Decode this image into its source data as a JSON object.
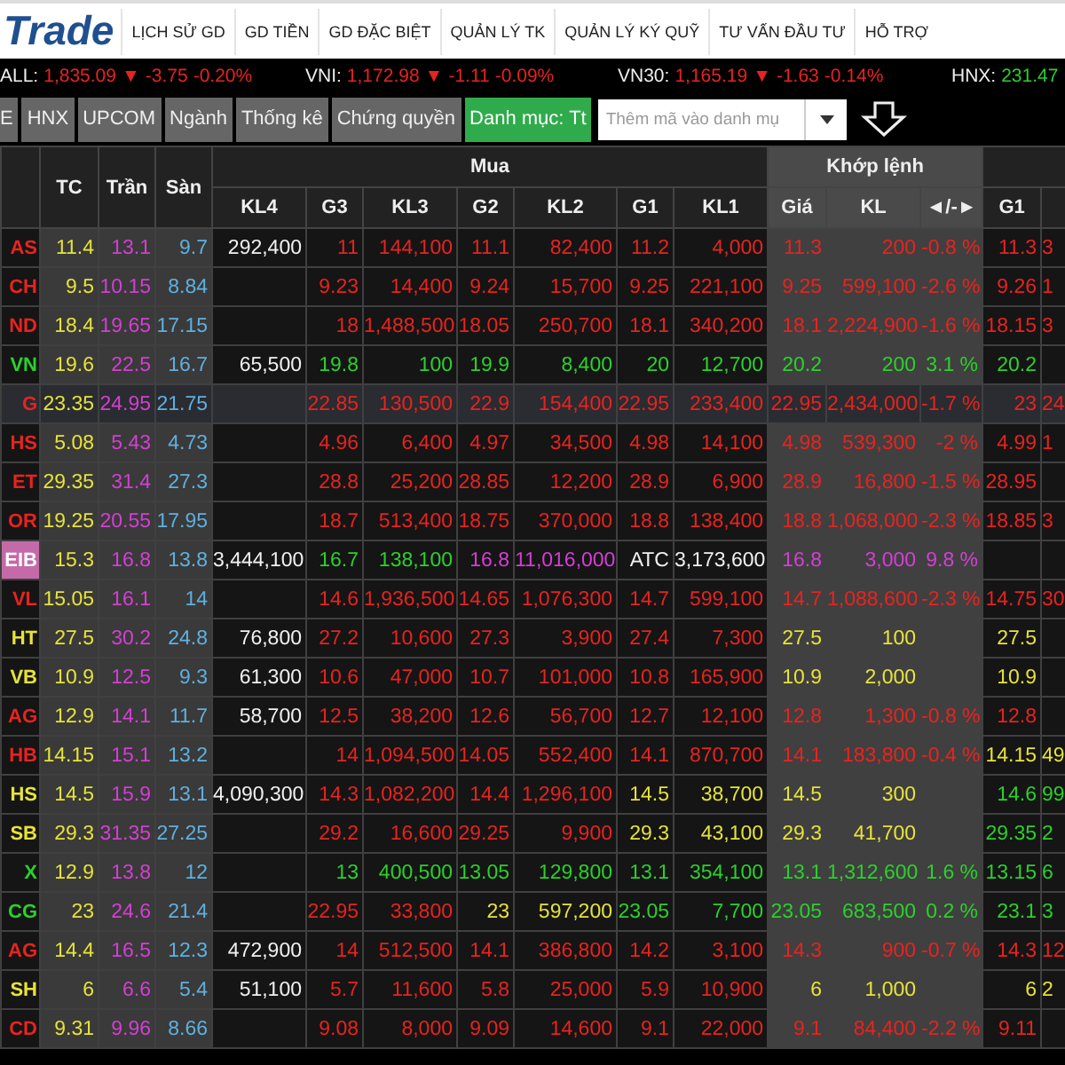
{
  "logo": "Trade",
  "menu": [
    "LỊCH SỬ GD",
    "GD TIỀN",
    "GD ĐẶC BIỆT",
    "QUẢN LÝ TK",
    "QUẢN LÝ KÝ QUỸ",
    "TƯ VẤN ĐẦU TƯ",
    "HỖ TRỢ"
  ],
  "indices": [
    {
      "label": "ALL:",
      "value": "1,835.09",
      "arrow": "▼",
      "change": "-3.75",
      "percent": "-0.20%",
      "color": "#e8231f"
    },
    {
      "label": "VNI:",
      "value": "1,172.98",
      "arrow": "▼",
      "change": "-1.11",
      "percent": "-0.09%",
      "color": "#e8231f"
    },
    {
      "label": "VN30:",
      "value": "1,165.19",
      "arrow": "▼",
      "change": "-1.63",
      "percent": "-0.14%",
      "color": "#e8231f"
    },
    {
      "label": "HNX:",
      "value": "231.47",
      "color": "#2bd12b"
    }
  ],
  "tabs": [
    {
      "label": "E",
      "selected": false
    },
    {
      "label": "HNX",
      "selected": false
    },
    {
      "label": "UPCOM",
      "selected": false
    },
    {
      "label": "Ngành",
      "selected": false
    },
    {
      "label": "Thống kê",
      "selected": false
    },
    {
      "label": "Chứng quyền",
      "selected": false
    },
    {
      "label": "Danh mục: Tt",
      "selected": true
    }
  ],
  "search": {
    "placeholder": "Thêm mã vào danh mụ"
  },
  "table": {
    "groups": [
      "Mua",
      "Khớp lệnh"
    ],
    "columns": [
      "TC",
      "Trần",
      "Sàn",
      "KL4",
      "G3",
      "KL3",
      "G2",
      "KL2",
      "G1",
      "KL1",
      "Giá",
      "KL",
      "◄/-►",
      "G1"
    ],
    "rows": [
      {
        "symbol": "AS",
        "color": "#e8231f",
        "selected": false,
        "highlighted": false,
        "cells": [
          {
            "text": "11.4",
            "color": "#e6e33a"
          },
          {
            "text": "13.1",
            "color": "#d43fd4"
          },
          {
            "text": "9.7",
            "color": "#5fb0e0"
          },
          {
            "text": "292,400",
            "color": "#f0f0f0"
          },
          {
            "text": "11",
            "color": "#e8231f"
          },
          {
            "text": "144,100",
            "color": "#e8231f"
          },
          {
            "text": "11.1",
            "color": "#e8231f"
          },
          {
            "text": "82,400",
            "color": "#e8231f"
          },
          {
            "text": "11.2",
            "color": "#e8231f"
          },
          {
            "text": "4,000",
            "color": "#e8231f"
          },
          {
            "text": "11.3",
            "color": "#e8231f"
          },
          {
            "text": "200",
            "color": "#e8231f"
          },
          {
            "text": "-0.8 %",
            "color": "#e8231f"
          },
          {
            "text": "11.3",
            "color": "#e8231f"
          },
          {
            "text": "3",
            "color": "#e8231f"
          }
        ]
      },
      {
        "symbol": "CH",
        "color": "#e8231f",
        "selected": false,
        "highlighted": false,
        "cells": [
          {
            "text": "9.5",
            "color": "#e6e33a"
          },
          {
            "text": "10.15",
            "color": "#d43fd4"
          },
          {
            "text": "8.84",
            "color": "#5fb0e0"
          },
          null,
          {
            "text": "9.23",
            "color": "#e8231f"
          },
          {
            "text": "14,400",
            "color": "#e8231f"
          },
          {
            "text": "9.24",
            "color": "#e8231f"
          },
          {
            "text": "15,700",
            "color": "#e8231f"
          },
          {
            "text": "9.25",
            "color": "#e8231f"
          },
          {
            "text": "221,100",
            "color": "#e8231f"
          },
          {
            "text": "9.25",
            "color": "#e8231f"
          },
          {
            "text": "599,100",
            "color": "#e8231f"
          },
          {
            "text": "-2.6 %",
            "color": "#e8231f"
          },
          {
            "text": "9.26",
            "color": "#e8231f"
          },
          {
            "text": "1",
            "color": "#e8231f"
          }
        ]
      },
      {
        "symbol": "ND",
        "color": "#e8231f",
        "selected": false,
        "highlighted": false,
        "cells": [
          {
            "text": "18.4",
            "color": "#e6e33a"
          },
          {
            "text": "19.65",
            "color": "#d43fd4"
          },
          {
            "text": "17.15",
            "color": "#5fb0e0"
          },
          null,
          {
            "text": "18",
            "color": "#e8231f"
          },
          {
            "text": "1,488,500",
            "color": "#e8231f"
          },
          {
            "text": "18.05",
            "color": "#e8231f"
          },
          {
            "text": "250,700",
            "color": "#e8231f"
          },
          {
            "text": "18.1",
            "color": "#e8231f"
          },
          {
            "text": "340,200",
            "color": "#e8231f"
          },
          {
            "text": "18.1",
            "color": "#e8231f"
          },
          {
            "text": "2,224,900",
            "color": "#e8231f"
          },
          {
            "text": "-1.6 %",
            "color": "#e8231f"
          },
          {
            "text": "18.15",
            "color": "#e8231f"
          },
          {
            "text": "3",
            "color": "#e8231f"
          }
        ]
      },
      {
        "symbol": "VN",
        "color": "#2bd12b",
        "selected": false,
        "highlighted": false,
        "cells": [
          {
            "text": "19.6",
            "color": "#e6e33a"
          },
          {
            "text": "22.5",
            "color": "#d43fd4"
          },
          {
            "text": "16.7",
            "color": "#5fb0e0"
          },
          {
            "text": "65,500",
            "color": "#f0f0f0"
          },
          {
            "text": "19.8",
            "color": "#2bd12b"
          },
          {
            "text": "100",
            "color": "#2bd12b"
          },
          {
            "text": "19.9",
            "color": "#2bd12b"
          },
          {
            "text": "8,400",
            "color": "#2bd12b"
          },
          {
            "text": "20",
            "color": "#2bd12b"
          },
          {
            "text": "12,700",
            "color": "#2bd12b"
          },
          {
            "text": "20.2",
            "color": "#2bd12b"
          },
          {
            "text": "200",
            "color": "#2bd12b"
          },
          {
            "text": "3.1 %",
            "color": "#2bd12b"
          },
          {
            "text": "20.2",
            "color": "#2bd12b"
          },
          null
        ]
      },
      {
        "symbol": "G",
        "color": "#e8231f",
        "selected": true,
        "highlighted": false,
        "cells": [
          {
            "text": "23.35",
            "color": "#e6e33a"
          },
          {
            "text": "24.95",
            "color": "#d43fd4"
          },
          {
            "text": "21.75",
            "color": "#5fb0e0"
          },
          null,
          {
            "text": "22.85",
            "color": "#e8231f"
          },
          {
            "text": "130,500",
            "color": "#e8231f"
          },
          {
            "text": "22.9",
            "color": "#e8231f"
          },
          {
            "text": "154,400",
            "color": "#e8231f"
          },
          {
            "text": "22.95",
            "color": "#e8231f"
          },
          {
            "text": "233,400",
            "color": "#e8231f"
          },
          {
            "text": "22.95",
            "color": "#e8231f"
          },
          {
            "text": "2,434,000",
            "color": "#e8231f"
          },
          {
            "text": "-1.7 %",
            "color": "#e8231f"
          },
          {
            "text": "23",
            "color": "#e8231f"
          },
          {
            "text": "24",
            "color": "#e8231f"
          }
        ]
      },
      {
        "symbol": "HS",
        "color": "#e8231f",
        "selected": false,
        "highlighted": false,
        "cells": [
          {
            "text": "5.08",
            "color": "#e6e33a"
          },
          {
            "text": "5.43",
            "color": "#d43fd4"
          },
          {
            "text": "4.73",
            "color": "#5fb0e0"
          },
          null,
          {
            "text": "4.96",
            "color": "#e8231f"
          },
          {
            "text": "6,400",
            "color": "#e8231f"
          },
          {
            "text": "4.97",
            "color": "#e8231f"
          },
          {
            "text": "34,500",
            "color": "#e8231f"
          },
          {
            "text": "4.98",
            "color": "#e8231f"
          },
          {
            "text": "14,100",
            "color": "#e8231f"
          },
          {
            "text": "4.98",
            "color": "#e8231f"
          },
          {
            "text": "539,300",
            "color": "#e8231f"
          },
          {
            "text": "-2 %",
            "color": "#e8231f"
          },
          {
            "text": "4.99",
            "color": "#e8231f"
          },
          {
            "text": "1",
            "color": "#e8231f"
          }
        ]
      },
      {
        "symbol": "ET",
        "color": "#e8231f",
        "selected": false,
        "highlighted": false,
        "cells": [
          {
            "text": "29.35",
            "color": "#e6e33a"
          },
          {
            "text": "31.4",
            "color": "#d43fd4"
          },
          {
            "text": "27.3",
            "color": "#5fb0e0"
          },
          null,
          {
            "text": "28.8",
            "color": "#e8231f"
          },
          {
            "text": "25,200",
            "color": "#e8231f"
          },
          {
            "text": "28.85",
            "color": "#e8231f"
          },
          {
            "text": "12,200",
            "color": "#e8231f"
          },
          {
            "text": "28.9",
            "color": "#e8231f"
          },
          {
            "text": "6,900",
            "color": "#e8231f"
          },
          {
            "text": "28.9",
            "color": "#e8231f"
          },
          {
            "text": "16,800",
            "color": "#e8231f"
          },
          {
            "text": "-1.5 %",
            "color": "#e8231f"
          },
          {
            "text": "28.95",
            "color": "#e8231f"
          },
          null
        ]
      },
      {
        "symbol": "OR",
        "color": "#e8231f",
        "selected": false,
        "highlighted": false,
        "cells": [
          {
            "text": "19.25",
            "color": "#e6e33a"
          },
          {
            "text": "20.55",
            "color": "#d43fd4"
          },
          {
            "text": "17.95",
            "color": "#5fb0e0"
          },
          null,
          {
            "text": "18.7",
            "color": "#e8231f"
          },
          {
            "text": "513,400",
            "color": "#e8231f"
          },
          {
            "text": "18.75",
            "color": "#e8231f"
          },
          {
            "text": "370,000",
            "color": "#e8231f"
          },
          {
            "text": "18.8",
            "color": "#e8231f"
          },
          {
            "text": "138,400",
            "color": "#e8231f"
          },
          {
            "text": "18.8",
            "color": "#e8231f"
          },
          {
            "text": "1,068,000",
            "color": "#e8231f"
          },
          {
            "text": "-2.3 %",
            "color": "#e8231f"
          },
          {
            "text": "18.85",
            "color": "#e8231f"
          },
          {
            "text": "3",
            "color": "#e8231f"
          }
        ]
      },
      {
        "symbol": "EIB",
        "color": "#ffffff",
        "selected": false,
        "highlighted": true,
        "cells": [
          {
            "text": "15.3",
            "color": "#e6e33a"
          },
          {
            "text": "16.8",
            "color": "#d43fd4"
          },
          {
            "text": "13.8",
            "color": "#5fb0e0"
          },
          {
            "text": "3,444,100",
            "color": "#f0f0f0"
          },
          {
            "text": "16.7",
            "color": "#2bd12b"
          },
          {
            "text": "138,100",
            "color": "#2bd12b"
          },
          {
            "text": "16.8",
            "color": "#d43fd4"
          },
          {
            "text": "11,016,000",
            "color": "#d43fd4"
          },
          {
            "text": "ATC",
            "color": "#f0f0f0"
          },
          {
            "text": "3,173,600",
            "color": "#f0f0f0"
          },
          {
            "text": "16.8",
            "color": "#d43fd4"
          },
          {
            "text": "3,000",
            "color": "#d43fd4"
          },
          {
            "text": "9.8 %",
            "color": "#d43fd4"
          },
          null,
          null
        ]
      },
      {
        "symbol": "VL",
        "color": "#e8231f",
        "selected": false,
        "highlighted": false,
        "cells": [
          {
            "text": "15.05",
            "color": "#e6e33a"
          },
          {
            "text": "16.1",
            "color": "#d43fd4"
          },
          {
            "text": "14",
            "color": "#5fb0e0"
          },
          null,
          {
            "text": "14.6",
            "color": "#e8231f"
          },
          {
            "text": "1,936,500",
            "color": "#e8231f"
          },
          {
            "text": "14.65",
            "color": "#e8231f"
          },
          {
            "text": "1,076,300",
            "color": "#e8231f"
          },
          {
            "text": "14.7",
            "color": "#e8231f"
          },
          {
            "text": "599,100",
            "color": "#e8231f"
          },
          {
            "text": "14.7",
            "color": "#e8231f"
          },
          {
            "text": "1,088,600",
            "color": "#e8231f"
          },
          {
            "text": "-2.3 %",
            "color": "#e8231f"
          },
          {
            "text": "14.75",
            "color": "#e8231f"
          },
          {
            "text": "30",
            "color": "#e8231f"
          }
        ]
      },
      {
        "symbol": "HT",
        "color": "#e6e33a",
        "selected": false,
        "highlighted": false,
        "cells": [
          {
            "text": "27.5",
            "color": "#e6e33a"
          },
          {
            "text": "30.2",
            "color": "#d43fd4"
          },
          {
            "text": "24.8",
            "color": "#5fb0e0"
          },
          {
            "text": "76,800",
            "color": "#f0f0f0"
          },
          {
            "text": "27.2",
            "color": "#e8231f"
          },
          {
            "text": "10,600",
            "color": "#e8231f"
          },
          {
            "text": "27.3",
            "color": "#e8231f"
          },
          {
            "text": "3,900",
            "color": "#e8231f"
          },
          {
            "text": "27.4",
            "color": "#e8231f"
          },
          {
            "text": "7,300",
            "color": "#e8231f"
          },
          {
            "text": "27.5",
            "color": "#e6e33a"
          },
          {
            "text": "100",
            "color": "#e6e33a"
          },
          null,
          {
            "text": "27.5",
            "color": "#e6e33a"
          },
          null
        ]
      },
      {
        "symbol": "VB",
        "color": "#e6e33a",
        "selected": false,
        "highlighted": false,
        "cells": [
          {
            "text": "10.9",
            "color": "#e6e33a"
          },
          {
            "text": "12.5",
            "color": "#d43fd4"
          },
          {
            "text": "9.3",
            "color": "#5fb0e0"
          },
          {
            "text": "61,300",
            "color": "#f0f0f0"
          },
          {
            "text": "10.6",
            "color": "#e8231f"
          },
          {
            "text": "47,000",
            "color": "#e8231f"
          },
          {
            "text": "10.7",
            "color": "#e8231f"
          },
          {
            "text": "101,000",
            "color": "#e8231f"
          },
          {
            "text": "10.8",
            "color": "#e8231f"
          },
          {
            "text": "165,900",
            "color": "#e8231f"
          },
          {
            "text": "10.9",
            "color": "#e6e33a"
          },
          {
            "text": "2,000",
            "color": "#e6e33a"
          },
          null,
          {
            "text": "10.9",
            "color": "#e6e33a"
          },
          null
        ]
      },
      {
        "symbol": "AG",
        "color": "#e8231f",
        "selected": false,
        "highlighted": false,
        "cells": [
          {
            "text": "12.9",
            "color": "#e6e33a"
          },
          {
            "text": "14.1",
            "color": "#d43fd4"
          },
          {
            "text": "11.7",
            "color": "#5fb0e0"
          },
          {
            "text": "58,700",
            "color": "#f0f0f0"
          },
          {
            "text": "12.5",
            "color": "#e8231f"
          },
          {
            "text": "38,200",
            "color": "#e8231f"
          },
          {
            "text": "12.6",
            "color": "#e8231f"
          },
          {
            "text": "56,700",
            "color": "#e8231f"
          },
          {
            "text": "12.7",
            "color": "#e8231f"
          },
          {
            "text": "12,100",
            "color": "#e8231f"
          },
          {
            "text": "12.8",
            "color": "#e8231f"
          },
          {
            "text": "1,300",
            "color": "#e8231f"
          },
          {
            "text": "-0.8 %",
            "color": "#e8231f"
          },
          {
            "text": "12.8",
            "color": "#e8231f"
          },
          null
        ]
      },
      {
        "symbol": "HB",
        "color": "#e8231f",
        "selected": false,
        "highlighted": false,
        "cells": [
          {
            "text": "14.15",
            "color": "#e6e33a"
          },
          {
            "text": "15.1",
            "color": "#d43fd4"
          },
          {
            "text": "13.2",
            "color": "#5fb0e0"
          },
          null,
          {
            "text": "14",
            "color": "#e8231f"
          },
          {
            "text": "1,094,500",
            "color": "#e8231f"
          },
          {
            "text": "14.05",
            "color": "#e8231f"
          },
          {
            "text": "552,400",
            "color": "#e8231f"
          },
          {
            "text": "14.1",
            "color": "#e8231f"
          },
          {
            "text": "870,700",
            "color": "#e8231f"
          },
          {
            "text": "14.1",
            "color": "#e8231f"
          },
          {
            "text": "183,800",
            "color": "#e8231f"
          },
          {
            "text": "-0.4 %",
            "color": "#e8231f"
          },
          {
            "text": "14.15",
            "color": "#e6e33a"
          },
          {
            "text": "49",
            "color": "#e6e33a"
          }
        ]
      },
      {
        "symbol": "HS",
        "color": "#e6e33a",
        "selected": false,
        "highlighted": false,
        "cells": [
          {
            "text": "14.5",
            "color": "#e6e33a"
          },
          {
            "text": "15.9",
            "color": "#d43fd4"
          },
          {
            "text": "13.1",
            "color": "#5fb0e0"
          },
          {
            "text": "4,090,300",
            "color": "#f0f0f0"
          },
          {
            "text": "14.3",
            "color": "#e8231f"
          },
          {
            "text": "1,082,200",
            "color": "#e8231f"
          },
          {
            "text": "14.4",
            "color": "#e8231f"
          },
          {
            "text": "1,296,100",
            "color": "#e8231f"
          },
          {
            "text": "14.5",
            "color": "#e6e33a"
          },
          {
            "text": "38,700",
            "color": "#e6e33a"
          },
          {
            "text": "14.5",
            "color": "#e6e33a"
          },
          {
            "text": "300",
            "color": "#e6e33a"
          },
          null,
          {
            "text": "14.6",
            "color": "#2bd12b"
          },
          {
            "text": "99",
            "color": "#2bd12b"
          }
        ]
      },
      {
        "symbol": "SB",
        "color": "#e6e33a",
        "selected": false,
        "highlighted": false,
        "cells": [
          {
            "text": "29.3",
            "color": "#e6e33a"
          },
          {
            "text": "31.35",
            "color": "#d43fd4"
          },
          {
            "text": "27.25",
            "color": "#5fb0e0"
          },
          null,
          {
            "text": "29.2",
            "color": "#e8231f"
          },
          {
            "text": "16,600",
            "color": "#e8231f"
          },
          {
            "text": "29.25",
            "color": "#e8231f"
          },
          {
            "text": "9,900",
            "color": "#e8231f"
          },
          {
            "text": "29.3",
            "color": "#e6e33a"
          },
          {
            "text": "43,100",
            "color": "#e6e33a"
          },
          {
            "text": "29.3",
            "color": "#e6e33a"
          },
          {
            "text": "41,700",
            "color": "#e6e33a"
          },
          null,
          {
            "text": "29.35",
            "color": "#2bd12b"
          },
          {
            "text": "2",
            "color": "#2bd12b"
          }
        ]
      },
      {
        "symbol": "X",
        "color": "#2bd12b",
        "selected": false,
        "highlighted": false,
        "cells": [
          {
            "text": "12.9",
            "color": "#e6e33a"
          },
          {
            "text": "13.8",
            "color": "#d43fd4"
          },
          {
            "text": "12",
            "color": "#5fb0e0"
          },
          null,
          {
            "text": "13",
            "color": "#2bd12b"
          },
          {
            "text": "400,500",
            "color": "#2bd12b"
          },
          {
            "text": "13.05",
            "color": "#2bd12b"
          },
          {
            "text": "129,800",
            "color": "#2bd12b"
          },
          {
            "text": "13.1",
            "color": "#2bd12b"
          },
          {
            "text": "354,100",
            "color": "#2bd12b"
          },
          {
            "text": "13.1",
            "color": "#2bd12b"
          },
          {
            "text": "1,312,600",
            "color": "#2bd12b"
          },
          {
            "text": "1.6 %",
            "color": "#2bd12b"
          },
          {
            "text": "13.15",
            "color": "#2bd12b"
          },
          {
            "text": "6",
            "color": "#2bd12b"
          }
        ]
      },
      {
        "symbol": "CG",
        "color": "#2bd12b",
        "selected": false,
        "highlighted": false,
        "cells": [
          {
            "text": "23",
            "color": "#e6e33a"
          },
          {
            "text": "24.6",
            "color": "#d43fd4"
          },
          {
            "text": "21.4",
            "color": "#5fb0e0"
          },
          null,
          {
            "text": "22.95",
            "color": "#e8231f"
          },
          {
            "text": "33,800",
            "color": "#e8231f"
          },
          {
            "text": "23",
            "color": "#e6e33a"
          },
          {
            "text": "597,200",
            "color": "#e6e33a"
          },
          {
            "text": "23.05",
            "color": "#2bd12b"
          },
          {
            "text": "7,700",
            "color": "#2bd12b"
          },
          {
            "text": "23.05",
            "color": "#2bd12b"
          },
          {
            "text": "683,500",
            "color": "#2bd12b"
          },
          {
            "text": "0.2 %",
            "color": "#2bd12b"
          },
          {
            "text": "23.1",
            "color": "#2bd12b"
          },
          {
            "text": "3",
            "color": "#2bd12b"
          }
        ]
      },
      {
        "symbol": "AG",
        "color": "#e8231f",
        "selected": false,
        "highlighted": false,
        "cells": [
          {
            "text": "14.4",
            "color": "#e6e33a"
          },
          {
            "text": "16.5",
            "color": "#d43fd4"
          },
          {
            "text": "12.3",
            "color": "#5fb0e0"
          },
          {
            "text": "472,900",
            "color": "#f0f0f0"
          },
          {
            "text": "14",
            "color": "#e8231f"
          },
          {
            "text": "512,500",
            "color": "#e8231f"
          },
          {
            "text": "14.1",
            "color": "#e8231f"
          },
          {
            "text": "386,800",
            "color": "#e8231f"
          },
          {
            "text": "14.2",
            "color": "#e8231f"
          },
          {
            "text": "3,100",
            "color": "#e8231f"
          },
          {
            "text": "14.3",
            "color": "#e8231f"
          },
          {
            "text": "900",
            "color": "#e8231f"
          },
          {
            "text": "-0.7 %",
            "color": "#e8231f"
          },
          {
            "text": "14.3",
            "color": "#e8231f"
          },
          {
            "text": "12",
            "color": "#e8231f"
          }
        ]
      },
      {
        "symbol": "SH",
        "color": "#e6e33a",
        "selected": false,
        "highlighted": false,
        "cells": [
          {
            "text": "6",
            "color": "#e6e33a"
          },
          {
            "text": "6.6",
            "color": "#d43fd4"
          },
          {
            "text": "5.4",
            "color": "#5fb0e0"
          },
          {
            "text": "51,100",
            "color": "#f0f0f0"
          },
          {
            "text": "5.7",
            "color": "#e8231f"
          },
          {
            "text": "11,600",
            "color": "#e8231f"
          },
          {
            "text": "5.8",
            "color": "#e8231f"
          },
          {
            "text": "25,000",
            "color": "#e8231f"
          },
          {
            "text": "5.9",
            "color": "#e8231f"
          },
          {
            "text": "10,900",
            "color": "#e8231f"
          },
          {
            "text": "6",
            "color": "#e6e33a"
          },
          {
            "text": "1,000",
            "color": "#e6e33a"
          },
          null,
          {
            "text": "6",
            "color": "#e6e33a"
          },
          {
            "text": "2",
            "color": "#e6e33a"
          }
        ]
      },
      {
        "symbol": "CD",
        "color": "#e8231f",
        "selected": false,
        "highlighted": false,
        "cells": [
          {
            "text": "9.31",
            "color": "#e6e33a"
          },
          {
            "text": "9.96",
            "color": "#d43fd4"
          },
          {
            "text": "8.66",
            "color": "#5fb0e0"
          },
          null,
          {
            "text": "9.08",
            "color": "#e8231f"
          },
          {
            "text": "8,000",
            "color": "#e8231f"
          },
          {
            "text": "9.09",
            "color": "#e8231f"
          },
          {
            "text": "14,600",
            "color": "#e8231f"
          },
          {
            "text": "9.1",
            "color": "#e8231f"
          },
          {
            "text": "22,000",
            "color": "#e8231f"
          },
          {
            "text": "9.1",
            "color": "#e8231f"
          },
          {
            "text": "84,400",
            "color": "#e8231f"
          },
          {
            "text": "-2.2 %",
            "color": "#e8231f"
          },
          {
            "text": "9.11",
            "color": "#e8231f"
          },
          null
        ]
      }
    ]
  }
}
